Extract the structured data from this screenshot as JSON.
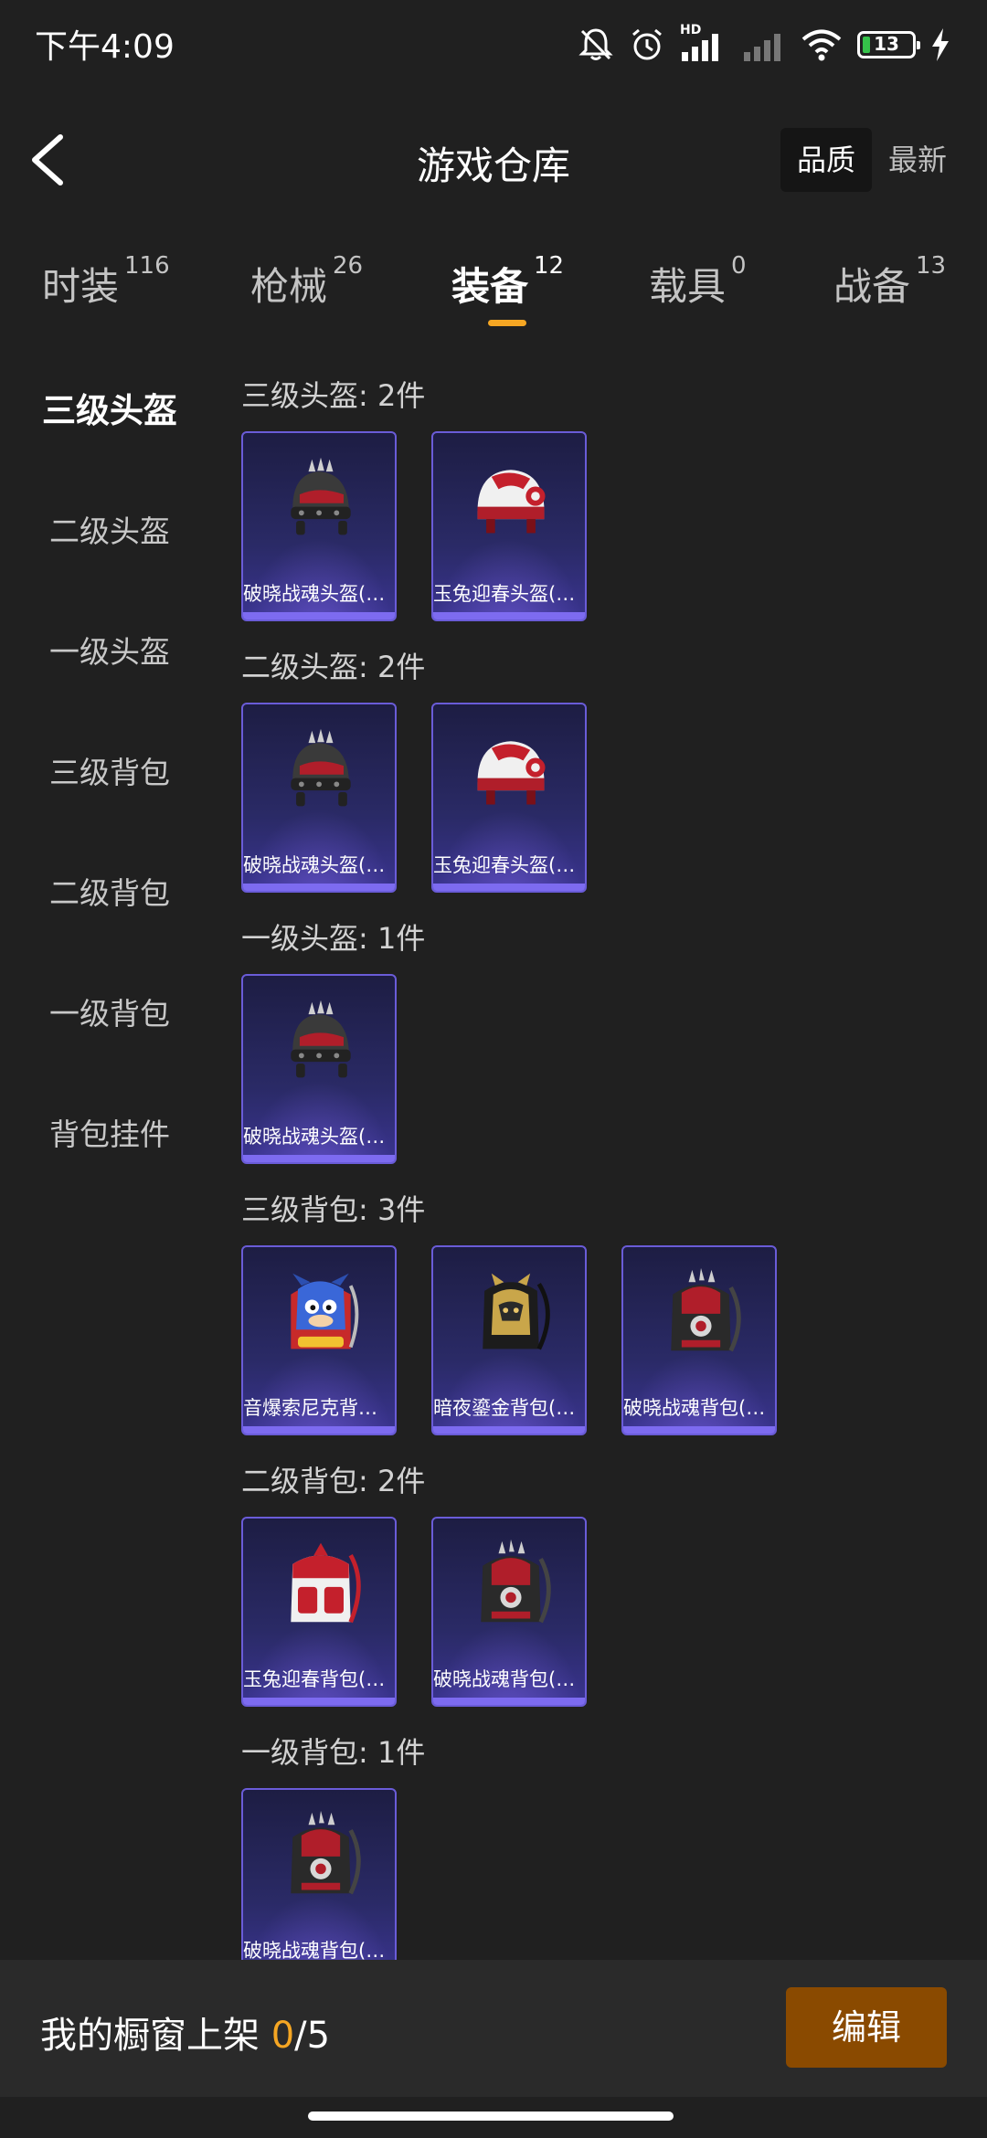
{
  "status_bar": {
    "time": "下午4:09",
    "battery_level": "13",
    "network_badge": "HD"
  },
  "header": {
    "title": "游戏仓库",
    "back_icon": "chevron-left-icon",
    "sort_options": [
      "品质",
      "最新"
    ],
    "sort_active": "品质"
  },
  "tabs": [
    {
      "label": "时装",
      "count": "116"
    },
    {
      "label": "枪械",
      "count": "26"
    },
    {
      "label": "装备",
      "count": "12",
      "active": true
    },
    {
      "label": "载具",
      "count": "0"
    },
    {
      "label": "战备",
      "count": "13"
    }
  ],
  "subnav": [
    "三级头盔",
    "二级头盔",
    "一级头盔",
    "三级背包",
    "二级背包",
    "一级背包",
    "背包挂件"
  ],
  "subnav_active": "三级头盔",
  "groups": [
    {
      "header": "三级头盔: 2件",
      "items": [
        {
          "name": "破晓战魂头盔(…",
          "icon": "spiked-helmet-icon"
        },
        {
          "name": "玉兔迎春头盔(…",
          "icon": "rabbit-helmet-icon"
        }
      ]
    },
    {
      "header": "二级头盔: 2件",
      "items": [
        {
          "name": "破晓战魂头盔(…",
          "icon": "spiked-helmet-icon"
        },
        {
          "name": "玉兔迎春头盔(…",
          "icon": "rabbit-helmet-icon"
        }
      ]
    },
    {
      "header": "一级头盔: 1件",
      "items": [
        {
          "name": "破晓战魂头盔(…",
          "icon": "spiked-helmet-icon"
        }
      ]
    },
    {
      "header": "三级背包: 3件",
      "items": [
        {
          "name": "音爆索尼克背…",
          "icon": "sonic-backpack-icon"
        },
        {
          "name": "暗夜鎏金背包(…",
          "icon": "gold-backpack-icon"
        },
        {
          "name": "破晓战魂背包(…",
          "icon": "spiked-backpack-icon"
        }
      ]
    },
    {
      "header": "二级背包: 2件",
      "items": [
        {
          "name": "玉兔迎春背包(…",
          "icon": "rabbit-backpack-icon"
        },
        {
          "name": "破晓战魂背包(…",
          "icon": "spiked-backpack-icon"
        }
      ]
    },
    {
      "header": "一级背包: 1件",
      "items": [
        {
          "name": "破晓战魂背包(…",
          "icon": "spiked-backpack-icon"
        }
      ]
    }
  ],
  "bottom_bar": {
    "showcase_label": "我的橱窗上架",
    "showcase_current": "0",
    "showcase_total": "/5",
    "edit_label": "编辑"
  },
  "colors": {
    "background": "#202020",
    "accent": "#f5a623",
    "edit_button": "#8a4a00",
    "card_border": "#6a5cd8"
  }
}
